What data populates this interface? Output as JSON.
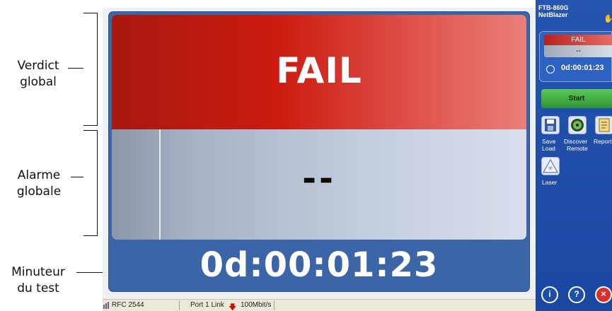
{
  "annotations": {
    "verdict_line1": "Verdict",
    "verdict_line2": "global",
    "alarm_line1": "Alarme",
    "alarm_line2": "globale",
    "timer_line1": "Minuteur",
    "timer_line2": "du test"
  },
  "main": {
    "verdict": "FAIL",
    "alarm": "--",
    "timer": "0d:00:01:23",
    "colors": {
      "verdict": "#cc1b10",
      "alarm": "#c4cddd",
      "panel": "#3c65a8"
    }
  },
  "statusbar": {
    "test_name": "RFC 2544",
    "port_label": "Port 1 Link",
    "speed": "100Mbit/s"
  },
  "sidebar": {
    "device_model": "FTB-860G",
    "device_name": "NetBlazer",
    "mini_verdict": "FAIL",
    "mini_alarm": "--",
    "mini_timer": "0d:00:01:23",
    "start_label": "Start",
    "tools": [
      {
        "label1": "Save",
        "label2": "Load",
        "icon": "save-load-icon"
      },
      {
        "label1": "Discover",
        "label2": "Remote",
        "icon": "discover-remote-icon"
      },
      {
        "label1": "Report",
        "label2": "",
        "icon": "report-icon"
      },
      {
        "label1": "Laser",
        "label2": "",
        "icon": "laser-icon"
      }
    ],
    "bottom_buttons": [
      "info-icon",
      "help-icon",
      "close-icon"
    ]
  }
}
